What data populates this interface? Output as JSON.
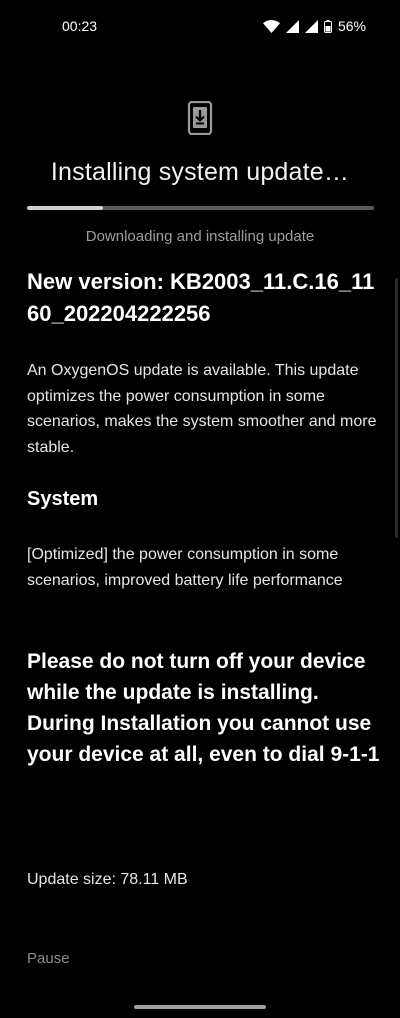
{
  "status_bar": {
    "time": "00:23",
    "battery": "56%",
    "icons": [
      "wifi-icon",
      "signal-icon",
      "signal-icon",
      "battery-icon"
    ]
  },
  "header": {
    "icon": "phone-download-icon",
    "title": "Installing system update…"
  },
  "progress": {
    "fraction": 0.22,
    "caption": "Downloading and installing update"
  },
  "content": {
    "version_title": "New version: KB2003_11.C.16_1160_202204222256",
    "description": "An OxygenOS update is available. This update optimizes the power consumption in some scenarios, makes the system smoother and more stable.",
    "section_title": "System",
    "section_body": "[Optimized] the power consumption in some scenarios, improved battery life performance",
    "warning": "Please do not turn off your device while the update is installing. During Installation you cannot use your device at all, even to dial 9-1-1",
    "update_size": "Update size: 78.11 MB"
  },
  "actions": {
    "pause_label": "Pause"
  },
  "colors": {
    "background": "#000000",
    "progress_fill": "#cfcfcf",
    "progress_track": "#5a5a5a",
    "muted_text": "#9e9e9e"
  }
}
